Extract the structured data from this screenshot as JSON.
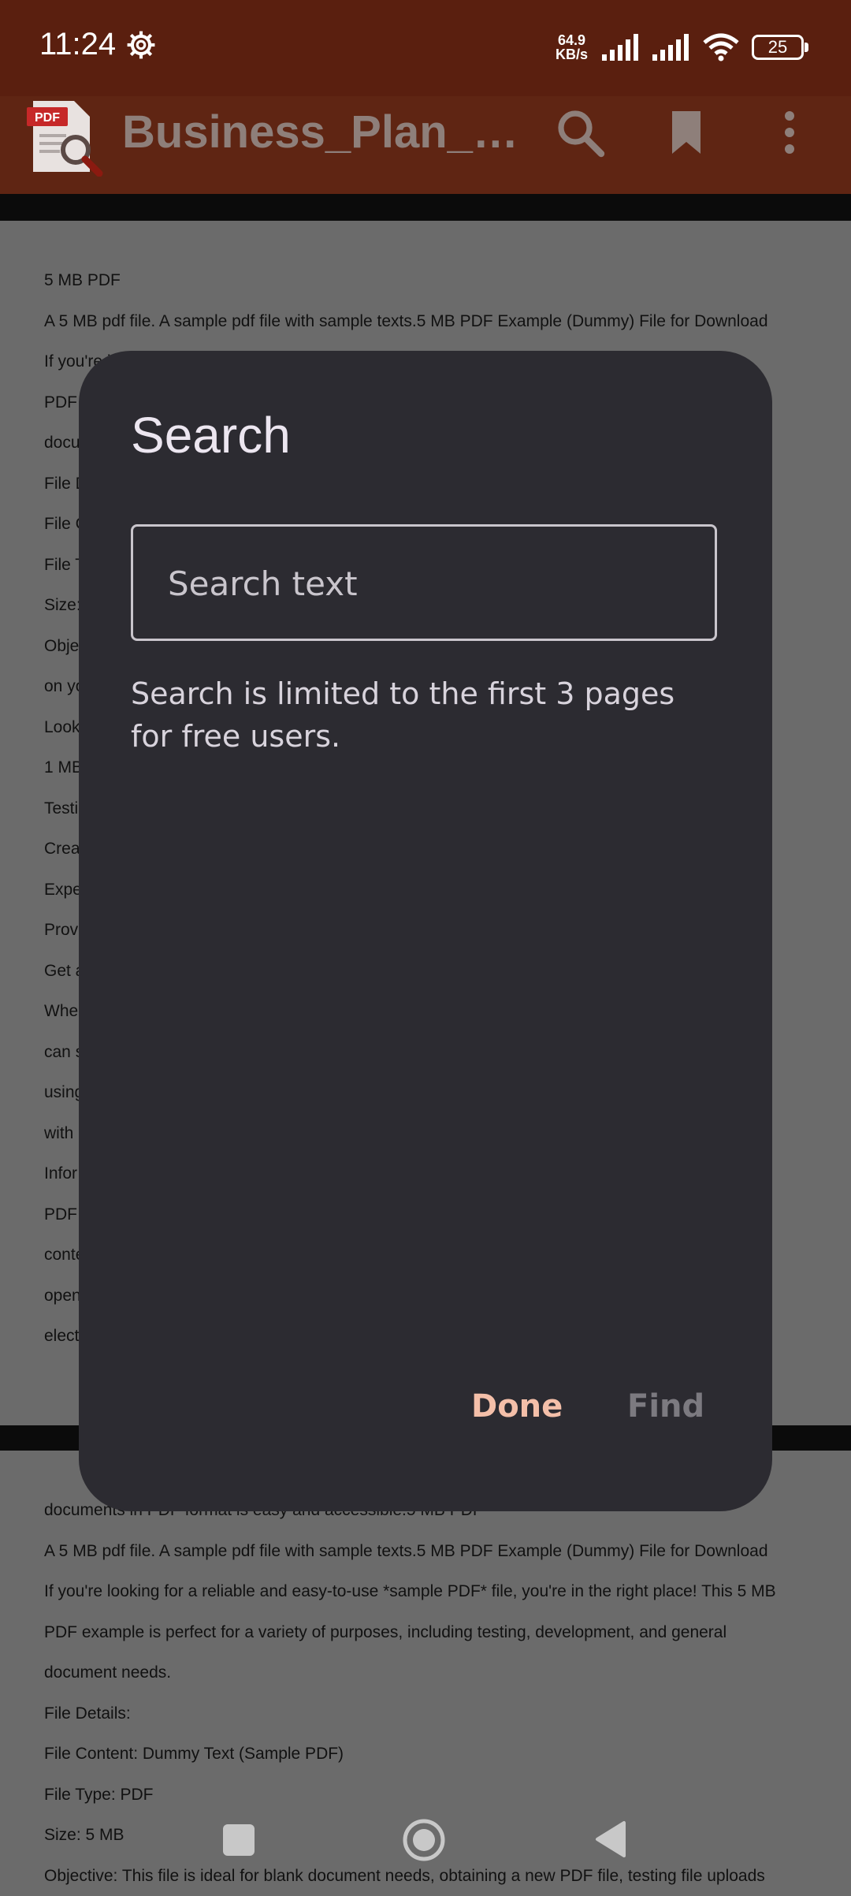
{
  "status": {
    "time": "11:24",
    "net_speed_value": "64.9",
    "net_speed_unit": "KB/s",
    "battery": "25",
    "icons": [
      "settings-gear-icon",
      "signal-icon",
      "signal-icon",
      "wifi-icon",
      "battery-icon"
    ]
  },
  "appbar": {
    "logo_text": "PDF",
    "title": "Business_Plan_D...",
    "actions": [
      "search-icon",
      "bookmark-icon",
      "more-vert-icon"
    ]
  },
  "doc": {
    "page1_lines": [
      "5 MB PDF",
      "A 5 MB pdf file. A sample pdf file with sample texts.5 MB PDF Example (Dummy) File for Download",
      "If you're                                                                                                              is 5 MB",
      "PDF",
      "docu",
      "File D",
      "File C",
      "File T",
      "Size:",
      "Obje                                                                                                                   ds",
      "on yo",
      "Look                                                                                                                   Our",
      "1 MB",
      "Testi",
      "Crea",
      "Expe",
      "Prov",
      "Get a",
      "Whe                                                                                                                    DF*",
      "can s                                                                                                                  start",
      "using                                                                                                                  d",
      "with",
      "Infor",
      "PDF                                                                                                                    rich",
      "conte",
      "open",
      "elect                                                                                                                  ing"
    ],
    "page2_lines": [
      "documents in PDF format is easy and accessible.5 MB PDF",
      "A 5 MB pdf file. A sample pdf file with sample texts.5 MB PDF Example (Dummy) File for Download",
      "If you're looking for a reliable and easy-to-use *sample PDF* file, you're in the right place! This 5 MB",
      "PDF example is perfect for a variety of purposes, including testing, development, and general",
      "document needs.",
      "File Details:",
      "File Content: Dummy Text (Sample PDF)",
      "File Type: PDF",
      "Size: 5 MB",
      "Objective: This file is ideal for blank document needs, obtaining a new PDF file, testing file uploads"
    ]
  },
  "dialog": {
    "title": "Search",
    "search_placeholder": "Search text",
    "search_value": "",
    "notice": "Search is limited to the first 3 pages for free users.",
    "done_label": "Done",
    "find_label": "Find"
  },
  "navbar": {
    "buttons": [
      "recents-square-icon",
      "home-circle-icon",
      "back-triangle-icon"
    ]
  }
}
